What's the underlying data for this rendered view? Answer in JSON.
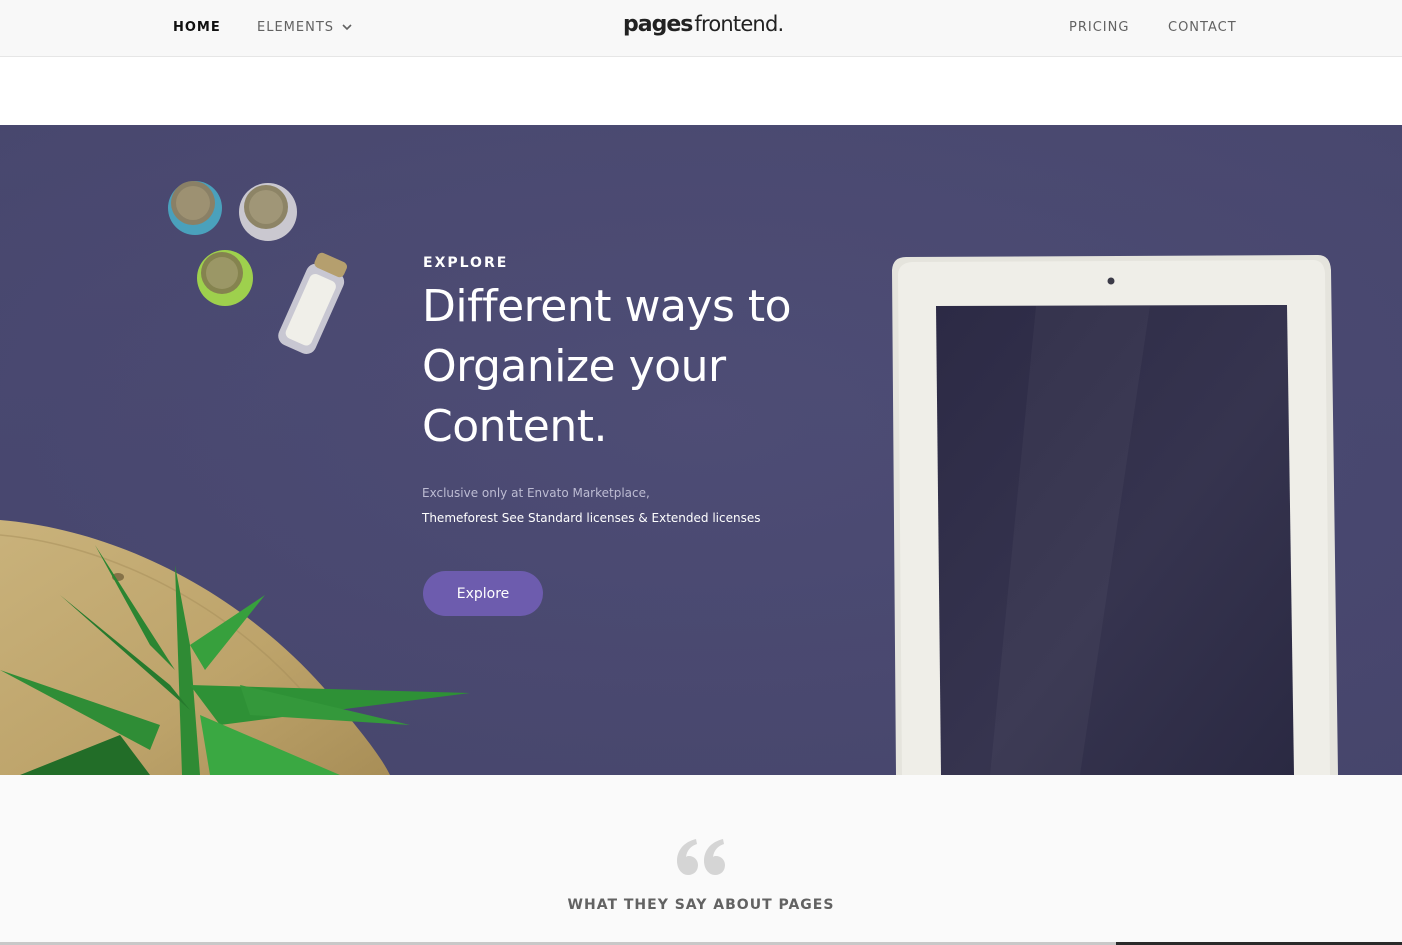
{
  "nav": {
    "home_label": "HOME",
    "elements_label": "ELEMENTS",
    "pricing_label": "PRICING",
    "contact_label": "CONTACT",
    "logo_bold": "pages",
    "logo_light": "frontend."
  },
  "hero": {
    "eyebrow": "EXPLORE",
    "headline": "Different ways to Organize your Content.",
    "subtext_line1": "Exclusive only at Envato Marketplace,",
    "subtext_line2": "Themeforest See Standard licenses & Extended licenses",
    "button_label": "Explore"
  },
  "testimonials": {
    "title": "WHAT THEY SAY ABOUT PAGES"
  },
  "colors": {
    "hero_bg": "#4a4971",
    "accent_button": "#6d5cae",
    "header_bg": "#f8f8f8",
    "text_dark": "#111111",
    "text_muted": "#626262"
  },
  "icons": [
    "chevron-down-icon",
    "quote-icon"
  ]
}
